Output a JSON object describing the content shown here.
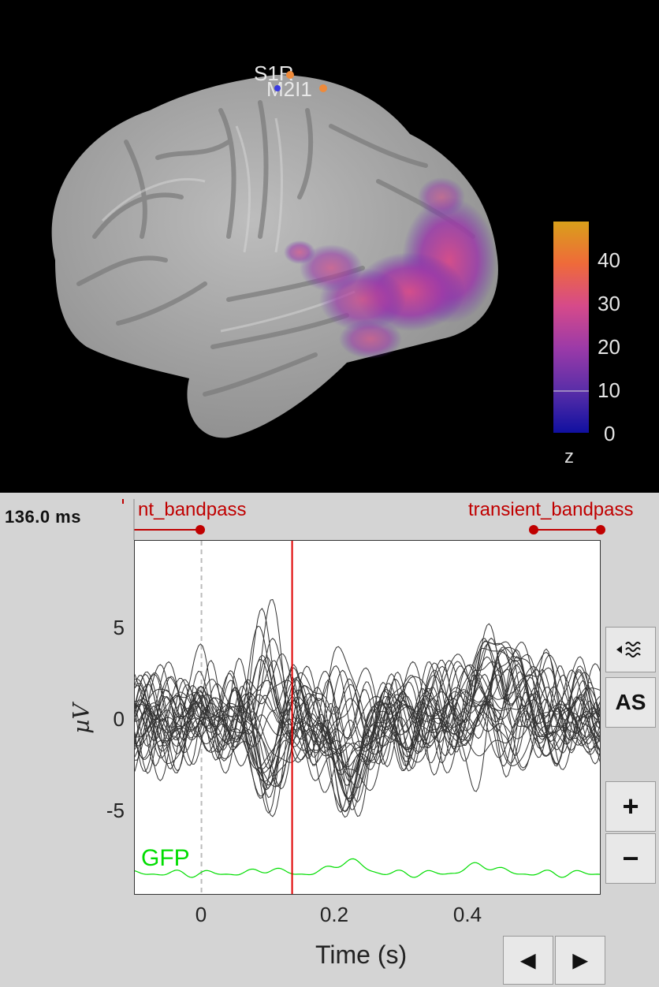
{
  "brain_view": {
    "labels": [
      "S1R",
      "M2I1"
    ],
    "colorbar": {
      "ticks": [
        "40",
        "30",
        "20",
        "10",
        "0"
      ],
      "unit": "z",
      "colors": [
        "#1a1aa6",
        "#5a2ea8",
        "#9b3aa8",
        "#d64a8a",
        "#ef6a3a",
        "#d9a01a"
      ]
    }
  },
  "time_readout": "136.0 ms",
  "events": {
    "left_label": "nt_bandpass",
    "right_label": "transient_bandpass",
    "color": "#c00000"
  },
  "plot": {
    "y_ticks": [
      "5",
      "0",
      "-5"
    ],
    "x_ticks": [
      "0",
      "0.2",
      "0.4"
    ],
    "y_label": "µV",
    "x_label": "Time (s)",
    "gfp_label": "GFP",
    "cursor_time": 0.136,
    "cursor_color": "#e00000",
    "gfp_color": "#00dd00"
  },
  "buttons": {
    "waveform_icon": "waveform-icon",
    "as_label": "AS",
    "zoom_in": "+",
    "zoom_out": "−",
    "prev": "◀",
    "next": "▶"
  }
}
